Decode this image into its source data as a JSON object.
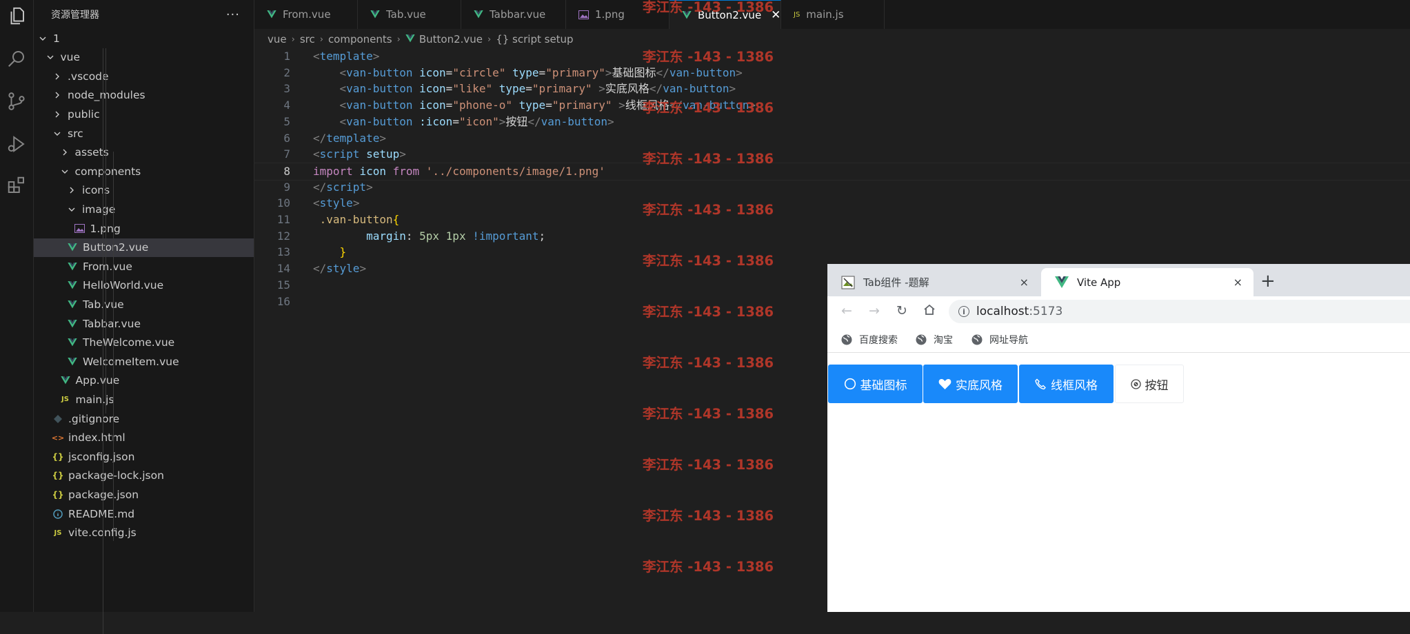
{
  "sidebar": {
    "title": "资源管理器",
    "more": "···",
    "tree": [
      {
        "label": "1",
        "type": "folder-open",
        "depth": 0
      },
      {
        "label": "vue",
        "type": "folder-open",
        "depth": 1
      },
      {
        "label": ".vscode",
        "type": "folder",
        "depth": 2
      },
      {
        "label": "node_modules",
        "type": "folder",
        "depth": 2
      },
      {
        "label": "public",
        "type": "folder",
        "depth": 2
      },
      {
        "label": "src",
        "type": "folder-open",
        "depth": 2
      },
      {
        "label": "assets",
        "type": "folder",
        "depth": 3
      },
      {
        "label": "components",
        "type": "folder-open",
        "depth": 3
      },
      {
        "label": "icons",
        "type": "folder",
        "depth": 4
      },
      {
        "label": "image",
        "type": "folder-open",
        "depth": 4
      },
      {
        "label": "1.png",
        "type": "image",
        "depth": 5
      },
      {
        "label": "Button2.vue",
        "type": "vue",
        "depth": 4,
        "selected": true
      },
      {
        "label": "From.vue",
        "type": "vue",
        "depth": 4
      },
      {
        "label": "HelloWorld.vue",
        "type": "vue",
        "depth": 4
      },
      {
        "label": "Tab.vue",
        "type": "vue",
        "depth": 4
      },
      {
        "label": "Tabbar.vue",
        "type": "vue",
        "depth": 4
      },
      {
        "label": "TheWelcome.vue",
        "type": "vue",
        "depth": 4
      },
      {
        "label": "WelcomeItem.vue",
        "type": "vue",
        "depth": 4
      },
      {
        "label": "App.vue",
        "type": "vue",
        "depth": 3
      },
      {
        "label": "main.js",
        "type": "js",
        "depth": 3
      },
      {
        "label": ".gitignore",
        "type": "git",
        "depth": 2
      },
      {
        "label": "index.html",
        "type": "html",
        "depth": 2
      },
      {
        "label": "jsconfig.json",
        "type": "json",
        "depth": 2
      },
      {
        "label": "package-lock.json",
        "type": "json",
        "depth": 2
      },
      {
        "label": "package.json",
        "type": "json",
        "depth": 2
      },
      {
        "label": "README.md",
        "type": "info",
        "depth": 2
      },
      {
        "label": "vite.config.js",
        "type": "js",
        "depth": 2
      }
    ]
  },
  "tabs": [
    {
      "label": "From.vue",
      "type": "vue"
    },
    {
      "label": "Tab.vue",
      "type": "vue"
    },
    {
      "label": "Tabbar.vue",
      "type": "vue"
    },
    {
      "label": "1.png",
      "type": "image"
    },
    {
      "label": "Button2.vue",
      "type": "vue",
      "active": true
    },
    {
      "label": "main.js",
      "type": "js"
    }
  ],
  "breadcrumb": [
    "vue",
    "src",
    "components",
    "Button2.vue",
    "{} script setup"
  ],
  "code": {
    "current_line": 8,
    "lines": [
      [
        [
          "tagp",
          "<"
        ],
        [
          "tag",
          "template"
        ],
        [
          "tagp",
          ">"
        ]
      ],
      [
        [
          "txt",
          "    "
        ],
        [
          "tagp",
          "<"
        ],
        [
          "tag",
          "van-button"
        ],
        [
          "txt",
          " "
        ],
        [
          "attr",
          "icon"
        ],
        [
          "txt",
          "="
        ],
        [
          "str",
          "\"circle\""
        ],
        [
          "txt",
          " "
        ],
        [
          "attr",
          "type"
        ],
        [
          "txt",
          "="
        ],
        [
          "str",
          "\"primary\""
        ],
        [
          "tagp",
          ">"
        ],
        [
          "txt",
          "基础图标"
        ],
        [
          "tagp",
          "</"
        ],
        [
          "tag",
          "van-button"
        ],
        [
          "tagp",
          ">"
        ]
      ],
      [
        [
          "txt",
          "    "
        ],
        [
          "tagp",
          "<"
        ],
        [
          "tag",
          "van-button"
        ],
        [
          "txt",
          " "
        ],
        [
          "attr",
          "icon"
        ],
        [
          "txt",
          "="
        ],
        [
          "str",
          "\"like\""
        ],
        [
          "txt",
          " "
        ],
        [
          "attr",
          "type"
        ],
        [
          "txt",
          "="
        ],
        [
          "str",
          "\"primary\""
        ],
        [
          "txt",
          " "
        ],
        [
          "tagp",
          ">"
        ],
        [
          "txt",
          "实底风格"
        ],
        [
          "tagp",
          "</"
        ],
        [
          "tag",
          "van-button"
        ],
        [
          "tagp",
          ">"
        ]
      ],
      [
        [
          "txt",
          "    "
        ],
        [
          "tagp",
          "<"
        ],
        [
          "tag",
          "van-button"
        ],
        [
          "txt",
          " "
        ],
        [
          "attr",
          "icon"
        ],
        [
          "txt",
          "="
        ],
        [
          "str",
          "\"phone-o\""
        ],
        [
          "txt",
          " "
        ],
        [
          "attr",
          "type"
        ],
        [
          "txt",
          "="
        ],
        [
          "str",
          "\"primary\""
        ],
        [
          "txt",
          " "
        ],
        [
          "tagp",
          ">"
        ],
        [
          "txt",
          "线框风格"
        ],
        [
          "tagp",
          "</"
        ],
        [
          "tag",
          "van-button"
        ],
        [
          "tagp",
          ">"
        ]
      ],
      [
        [
          "txt",
          "    "
        ],
        [
          "tagp",
          "<"
        ],
        [
          "tag",
          "van-button"
        ],
        [
          "txt",
          " "
        ],
        [
          "attr",
          ":icon"
        ],
        [
          "txt",
          "="
        ],
        [
          "str",
          "\"icon\""
        ],
        [
          "tagp",
          ">"
        ],
        [
          "txt",
          "按钮"
        ],
        [
          "tagp",
          "</"
        ],
        [
          "tag",
          "van-button"
        ],
        [
          "tagp",
          ">"
        ]
      ],
      [
        [
          "tagp",
          "</"
        ],
        [
          "tag",
          "template"
        ],
        [
          "tagp",
          ">"
        ]
      ],
      [
        [
          "tagp",
          "<"
        ],
        [
          "tag",
          "script"
        ],
        [
          "txt",
          " "
        ],
        [
          "attr",
          "setup"
        ],
        [
          "tagp",
          ">"
        ]
      ],
      [
        [
          "kw",
          "import"
        ],
        [
          "txt",
          " "
        ],
        [
          "var",
          "icon"
        ],
        [
          "txt",
          " "
        ],
        [
          "kw",
          "from"
        ],
        [
          "txt",
          " "
        ],
        [
          "str",
          "'../components/image/1.png'"
        ]
      ],
      [
        [
          "tagp",
          "</"
        ],
        [
          "tag",
          "script"
        ],
        [
          "tagp",
          ">"
        ]
      ],
      [
        [
          "tagp",
          "<"
        ],
        [
          "tag",
          "style"
        ],
        [
          "tagp",
          ">"
        ]
      ],
      [
        [
          "txt",
          " "
        ],
        [
          "sel",
          ".van-button"
        ],
        [
          "brace",
          "{"
        ]
      ],
      [
        [
          "txt",
          "        "
        ],
        [
          "attr",
          "margin"
        ],
        [
          "txt",
          ": "
        ],
        [
          "num",
          "5px"
        ],
        [
          "txt",
          " "
        ],
        [
          "num",
          "1px"
        ],
        [
          "txt",
          " "
        ],
        [
          "imp",
          "!important"
        ],
        [
          "txt",
          ";"
        ]
      ],
      [
        [
          "txt",
          "    "
        ],
        [
          "brace",
          "}"
        ]
      ],
      [
        [
          "tagp",
          "</"
        ],
        [
          "tag",
          "style"
        ],
        [
          "tagp",
          ">"
        ]
      ],
      [],
      []
    ]
  },
  "watermark": {
    "text": "李江东 -143 - 1386",
    "color": "#c0392b",
    "count": 12
  },
  "browser": {
    "tabs": [
      {
        "label": "Tab组件 -题解",
        "active": false,
        "close": "×"
      },
      {
        "label": "Vite App",
        "active": true,
        "close": "×"
      }
    ],
    "new_tab": "+",
    "url_host": "localhost",
    "url_port": ":5173",
    "bookmarks": [
      "百度搜索",
      "淘宝",
      "网址导航"
    ],
    "buttons": [
      {
        "label": "基础图标",
        "icon": "circle-icon",
        "style": "primary"
      },
      {
        "label": "实底风格",
        "icon": "heart-icon",
        "style": "primary"
      },
      {
        "label": "线框风格",
        "icon": "phone-icon",
        "style": "primary"
      },
      {
        "label": "按钮",
        "icon": "custom-image-icon",
        "style": "default"
      }
    ],
    "primary_color": "#1989fa"
  }
}
